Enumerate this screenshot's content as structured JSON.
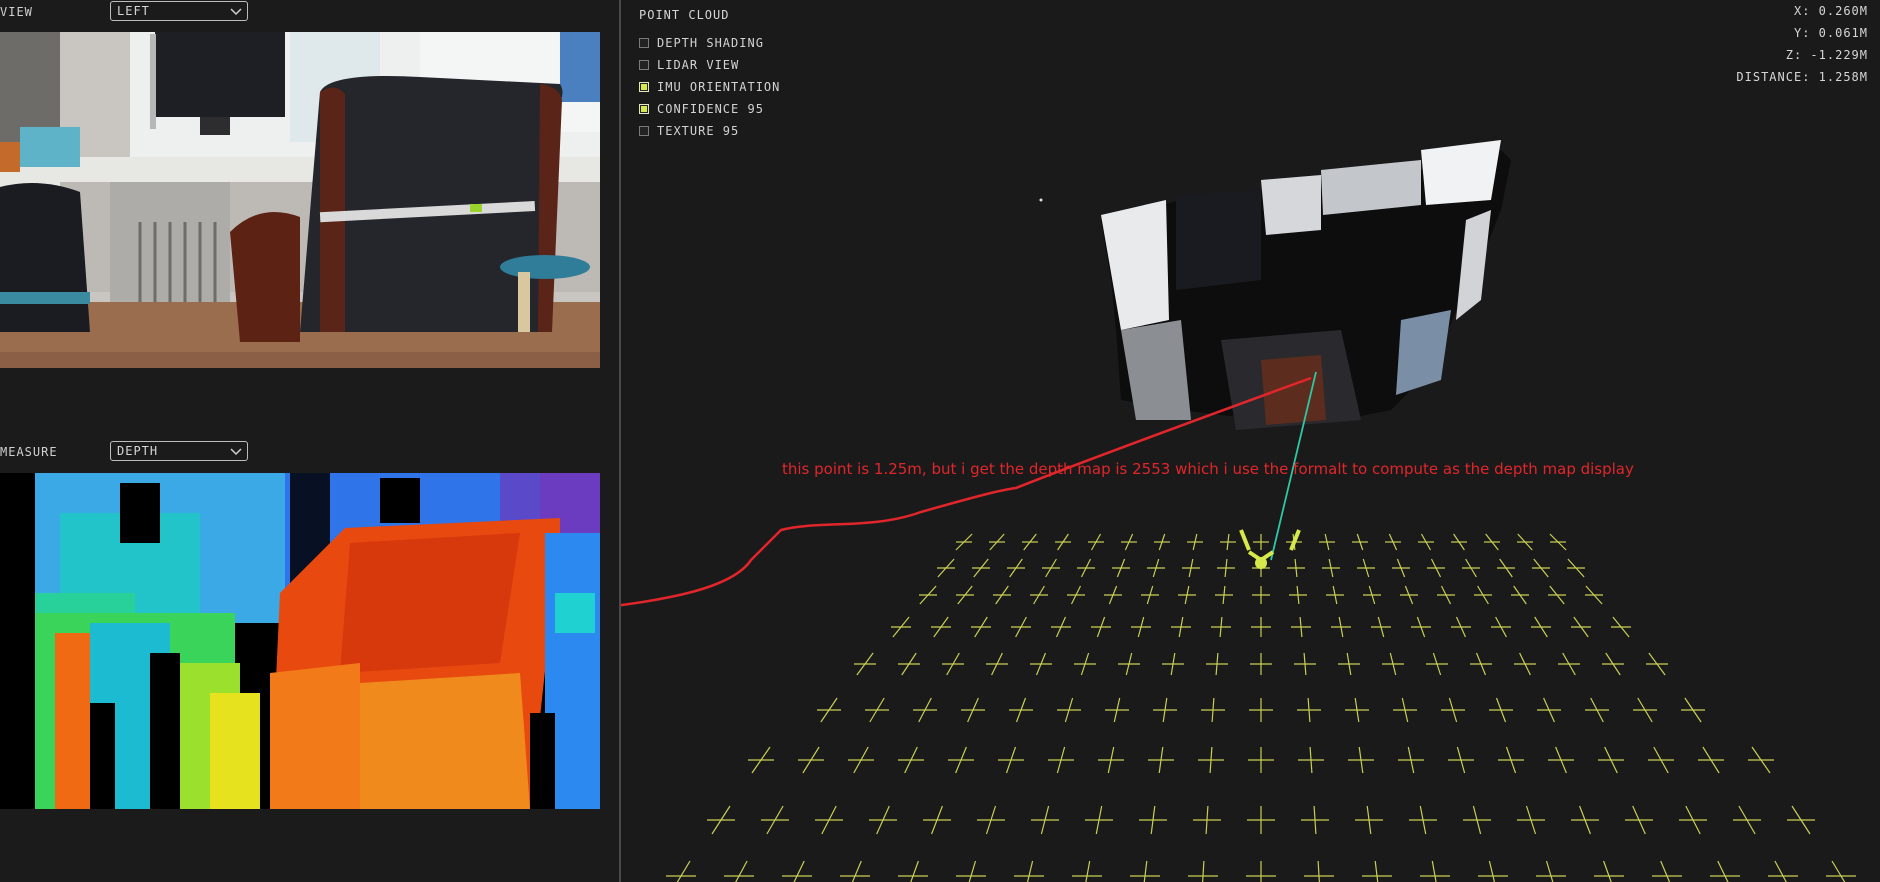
{
  "view": {
    "label": "VIEW",
    "selected": "LEFT"
  },
  "measure": {
    "label": "MEASURE",
    "selected": "DEPTH"
  },
  "point_cloud": {
    "title": "POINT CLOUD",
    "options": [
      {
        "label": "DEPTH SHADING",
        "checked": false
      },
      {
        "label": "LIDAR VIEW",
        "checked": false
      },
      {
        "label": "IMU ORIENTATION",
        "checked": true
      },
      {
        "label": "CONFIDENCE 95",
        "checked": true
      },
      {
        "label": "TEXTURE 95",
        "checked": false
      }
    ]
  },
  "readout": {
    "x": "X: 0.260M",
    "y": "Y: 0.061M",
    "z": "Z: -1.229M",
    "distance": "DISTANCE: 1.258M"
  },
  "annotation": {
    "text": "this point is  1.25m,  but i get the depth map is 2553  which i use the formalt to compute as the depth map display"
  },
  "colors": {
    "annotation": "#e1262b",
    "grid": "#c9cf55",
    "accent": "#d7e84a",
    "measure_line": "#2fc7a6"
  }
}
